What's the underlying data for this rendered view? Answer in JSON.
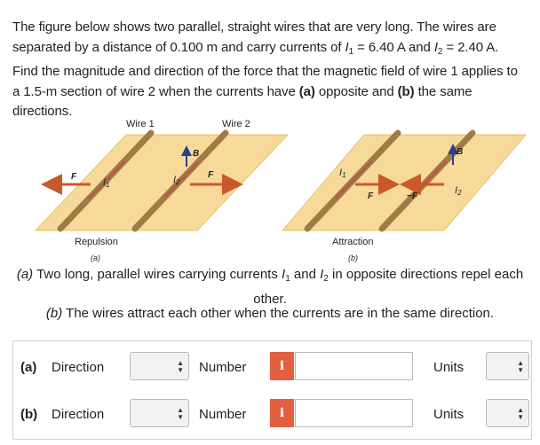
{
  "problem": {
    "t1": "The figure below shows two parallel, straight wires that are very long. The wires are separated by a distance of 0.100 m and carry currents of ",
    "I": "I",
    "one": "1",
    "two": "2",
    "t2": " = 6.40 A and ",
    "t3": " = 2.40 A. Find the magnitude and direction of the force that the magnetic field of wire 1 applies to a 1.5-m section of wire 2 when the currents have ",
    "a": "(a)",
    "t4": " opposite and ",
    "b": "(b)",
    "t5": " the same directions."
  },
  "figure": {
    "wire1": "Wire 1",
    "wire2": "Wire 2",
    "repulsion": "Repulsion",
    "attraction": "Attraction",
    "sub_a": "(a)",
    "sub_b": "(b)",
    "I1": "I",
    "I2": "I",
    "s1": "1",
    "s2": "2",
    "B": "B",
    "F": "F",
    "negF": "−F"
  },
  "caption_a": {
    "a": "(a)",
    "t1": " Two long, parallel wires carrying currents ",
    "I": "I",
    "s1": "1",
    "and": " and ",
    "s2": "2",
    "t2": " in opposite directions repel each other."
  },
  "caption_b": {
    "b": "(b)",
    "t": " The wires attract each other when the currents are in the same direction."
  },
  "answers": {
    "rows": [
      {
        "part": "(a)",
        "direction": "Direction",
        "number": "Number",
        "units": "Units",
        "value": ""
      },
      {
        "part": "(b)",
        "direction": "Direction",
        "number": "Number",
        "units": "Units",
        "value": ""
      }
    ],
    "info_glyph": "i",
    "arrow_up": "▲",
    "arrow_down": "▼"
  },
  "colors": {
    "board": "#f7d99a",
    "wire": "#b08a52",
    "current": "#c0504d",
    "force": "#c9582b",
    "field": "#2b3f8f",
    "info": "#e2603f"
  }
}
